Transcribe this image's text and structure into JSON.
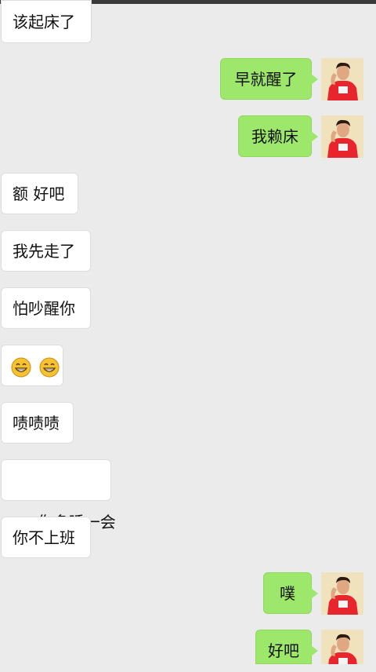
{
  "messages": [
    {
      "side": "in",
      "text": "该起床了"
    },
    {
      "side": "out",
      "text": "早就醒了"
    },
    {
      "side": "out",
      "text": "我赖床"
    },
    {
      "side": "in",
      "text": "额 好吧"
    },
    {
      "side": "in",
      "text": "我先走了"
    },
    {
      "side": "in",
      "text": "怕吵醒你"
    },
    {
      "side": "in",
      "emoji": [
        "grinning-face-icon",
        "grinning-face-icon"
      ]
    },
    {
      "side": "in",
      "text": "啧啧啧"
    },
    {
      "side": "in",
      "text": " 你多睡一会"
    },
    {
      "side": "in",
      "text": "你不上班"
    },
    {
      "side": "out",
      "text": "噗"
    },
    {
      "side": "out",
      "text": "好吧"
    }
  ],
  "colors": {
    "background": "#ebebeb",
    "incoming_bubble": "#ffffff",
    "outgoing_bubble": "#9de86a",
    "avatar_shirt": "#e8252c"
  }
}
